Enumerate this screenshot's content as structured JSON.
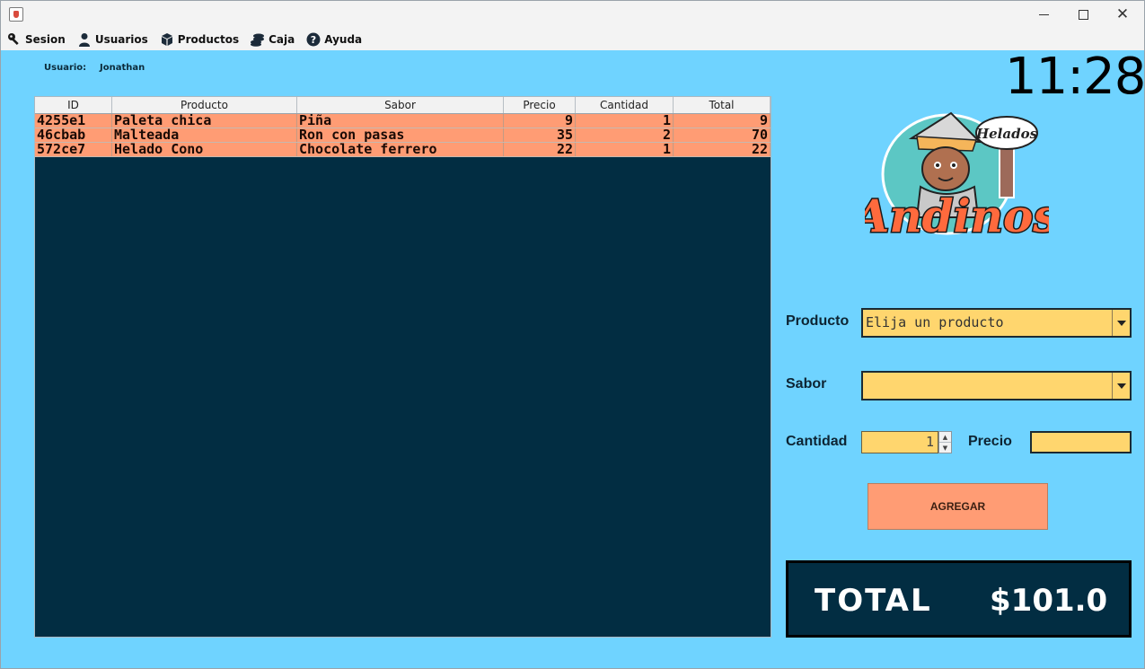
{
  "window": {
    "title": "",
    "controls": [
      "minimize",
      "maximize",
      "close"
    ]
  },
  "menu": [
    {
      "label": "Sesion",
      "icon": "key-icon"
    },
    {
      "label": "Usuarios",
      "icon": "user-icon"
    },
    {
      "label": "Productos",
      "icon": "boxes-icon"
    },
    {
      "label": "Caja",
      "icon": "coins-icon"
    },
    {
      "label": "Ayuda",
      "icon": "help-icon"
    }
  ],
  "header": {
    "user_label": "Usuario:",
    "user_name": "Jonathan",
    "clock": "11:28"
  },
  "table": {
    "columns": [
      "ID",
      "Producto",
      "Sabor",
      "Precio",
      "Cantidad",
      "Total"
    ],
    "rows": [
      [
        "4255e1",
        "Paleta chica",
        "Piña",
        "9",
        "1",
        "9"
      ],
      [
        "46cbab",
        "Malteada",
        "Ron con pasas",
        "35",
        "2",
        "70"
      ],
      [
        "572ce7",
        "Helado Cono",
        "Chocolate ferrero",
        "22",
        "1",
        "22"
      ]
    ]
  },
  "logo": {
    "badge_text": "Helados",
    "brand_text": "Andinos"
  },
  "form": {
    "producto_label": "Producto",
    "producto_value": "Elija un producto",
    "sabor_label": "Sabor",
    "sabor_value": "",
    "cantidad_label": "Cantidad",
    "cantidad_value": "1",
    "precio_label": "Precio",
    "precio_value": "",
    "agregar_label": "AGREGAR"
  },
  "total": {
    "label": "TOTAL",
    "value": "$101.0"
  },
  "colors": {
    "background": "#6fd3ff",
    "table_background": "#022d42",
    "row_background": "#ff9c74",
    "field_background": "#ffd66e",
    "button_background": "#ff9c74"
  }
}
